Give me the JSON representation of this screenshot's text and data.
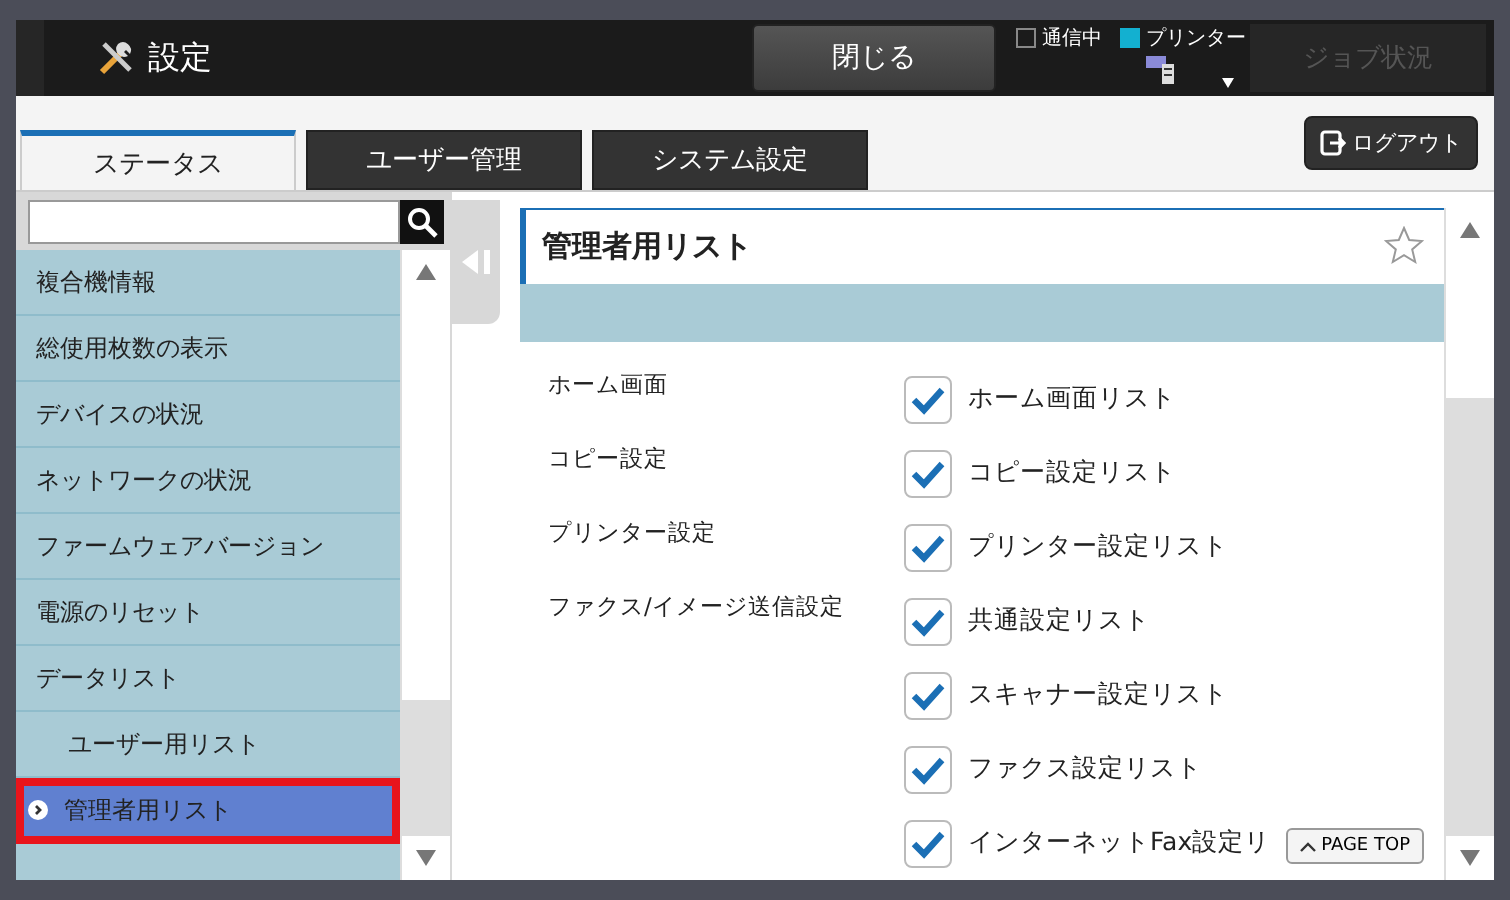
{
  "header": {
    "title": "設定",
    "close_button": "閉じる",
    "indicators": [
      {
        "label": "通信中",
        "on": false
      },
      {
        "label": "プリンター",
        "on": true
      }
    ],
    "job_button": {
      "label": "ジョブ状況",
      "disabled": true
    }
  },
  "tabs": [
    {
      "label": "ステータス",
      "selected": true
    },
    {
      "label": "ユーザー管理",
      "selected": false
    },
    {
      "label": "システム設定",
      "selected": false
    }
  ],
  "logout_button": "ログアウト",
  "sidebar": {
    "items": [
      {
        "label": "複合機情報",
        "selected": false,
        "highlighted": false
      },
      {
        "label": "総使用枚数の表示",
        "selected": false,
        "highlighted": false
      },
      {
        "label": "デバイスの状況",
        "selected": false,
        "highlighted": false
      },
      {
        "label": "ネットワークの状況",
        "selected": false,
        "highlighted": false
      },
      {
        "label": "ファームウェアバージョン",
        "selected": false,
        "highlighted": false
      },
      {
        "label": "電源のリセット",
        "selected": false,
        "highlighted": false
      },
      {
        "label": "データリスト",
        "selected": false,
        "highlighted": false,
        "children": [
          {
            "label": "ユーザー用リスト",
            "selected": false,
            "highlighted": false
          },
          {
            "label": "管理者用リスト",
            "selected": true,
            "highlighted": true
          }
        ]
      }
    ]
  },
  "content": {
    "title": "管理者用リスト",
    "favorite": false,
    "categories": [
      "ホーム画面",
      "コピー設定",
      "プリンター設定",
      "ファクス/イメージ送信設定"
    ],
    "lists": [
      {
        "label": "ホーム画面リスト",
        "checked": true
      },
      {
        "label": "コピー設定リスト",
        "checked": true
      },
      {
        "label": "プリンター設定リスト",
        "checked": true
      },
      {
        "label": "共通設定リスト",
        "checked": true
      },
      {
        "label": "スキャナー設定リスト",
        "checked": true
      },
      {
        "label": "ファクス設定リスト",
        "checked": true
      },
      {
        "label": "インターネットFax設定リ",
        "checked": true
      }
    ],
    "page_top_button": "PAGE TOP"
  }
}
